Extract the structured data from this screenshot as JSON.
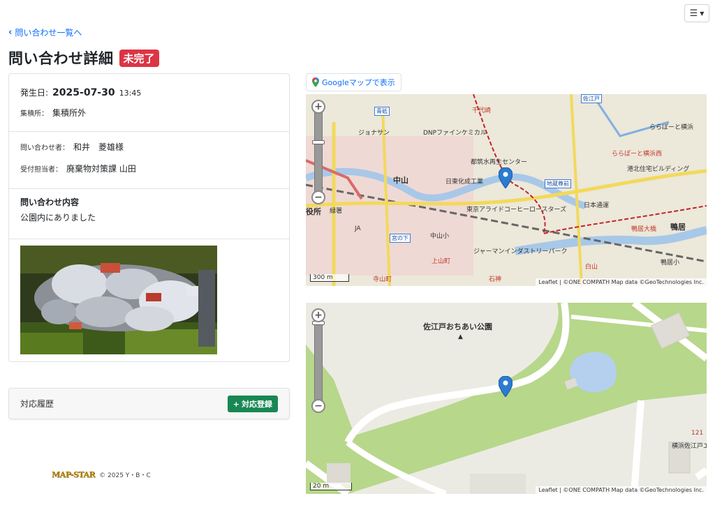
{
  "header": {
    "menu_icon": "hamburger-icon"
  },
  "nav": {
    "back_label": "問い合わせ一覧へ"
  },
  "page": {
    "title": "問い合わせ詳細",
    "status_badge": "未完了",
    "status_color": "#dc3545"
  },
  "detail": {
    "date_label": "発生日:",
    "date": "2025-07-30",
    "time": "13:45",
    "place_label": "集積所：",
    "place": "集積所外",
    "inquirer_label": "問い合わせ者：",
    "inquirer": "和井　菱雄様",
    "handler_label": "受付担当者：",
    "handler": "廃棄物対策課 山田",
    "content_title": "問い合わせ内容",
    "content": "公園内にありました"
  },
  "history": {
    "title": "対応履歴",
    "add_button": "対応登録"
  },
  "footer": {
    "logo": "MAP-STAR",
    "copyright": "© 2025 Y・B・C"
  },
  "map_link": {
    "label": "Googleマップで表示"
  },
  "map1": {
    "scale": "300 m",
    "attribution": "Leaflet | ©ONE COMPATH Map data ©GeoTechnologies Inc.",
    "labels": [
      "中山",
      "日東化成工業",
      "東京アライドコーヒーロースターズ",
      "ジャーマンインダストリーパーク",
      "港北住宅ビルディング",
      "日本通運",
      "DNPファインケミカル",
      "ジョナサン",
      "都筑水再生センター",
      "ららぽーと横浜",
      "鴨居",
      "役所",
      "緑署",
      "JA",
      "中山小",
      "佐江戸",
      "青砥",
      "宮の下",
      "地蔵尊前",
      "鴨居小",
      "上山町",
      "寺山町",
      "千代崎",
      "石神",
      "白山",
      "ららぽーと横浜西",
      "鴨居大橋"
    ]
  },
  "map2": {
    "scale": "20 m",
    "attribution": "Leaflet | ©ONE COMPATH Map data ©GeoTechnologies Inc.",
    "park_name": "佐江戸おちあい公園",
    "labels": [
      "121",
      "横浜佐江戸エ"
    ]
  }
}
